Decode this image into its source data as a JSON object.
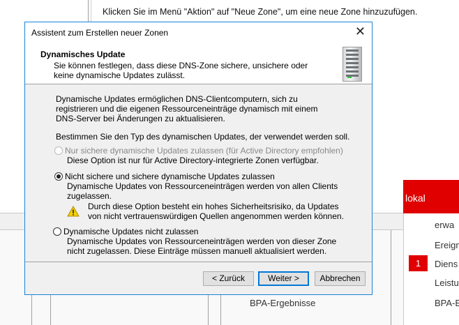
{
  "background": {
    "hint": "Klicken Sie im Menü \"Aktion\" auf \"Neue Zone\", um eine neue Zone hinzuzufügen.",
    "tile_title": "lokal",
    "tile_items": [
      "erwa",
      "Ereign",
      "Diens",
      "Leistu",
      "BPA-E"
    ],
    "badge_count": "1",
    "bpa_label": "BPA-Ergebnisse"
  },
  "dialog": {
    "title": "Assistent zum Erstellen neuer Zonen",
    "header_title": "Dynamisches Update",
    "header_desc": "Sie können festlegen, dass diese DNS-Zone sichere, unsichere oder keine dynamische Updates zulässt.",
    "intro": "Dynamische Updates ermöglichen DNS-Clientcomputern, sich zu registrieren und die eigenen Ressourceneinträge dynamisch mit einem DNS-Server bei Änderungen zu aktualisieren.",
    "prompt": "Bestimmen Sie den Typ des dynamischen Updates, der verwendet werden soll.",
    "options": [
      {
        "label": "Nur sichere dynamische Updates zulassen (für Active Directory empfohlen)",
        "desc": "Diese Option ist nur für Active Directory-integrierte Zonen verfügbar.",
        "state": "disabled"
      },
      {
        "label": "Nicht sichere und sichere dynamische Updates zulassen",
        "desc": "Dynamische Updates von Ressourceneinträgen werden von allen Clients zugelassen.",
        "warning": "Durch diese Option besteht ein hohes Sicherheitsrisiko, da Updates von nicht vertrauenswürdigen Quellen angenommen werden können.",
        "state": "selected"
      },
      {
        "label": "Dynamische Updates nicht zulassen",
        "desc": "Dynamische Updates von Ressourceneinträgen werden von dieser Zone nicht zugelassen. Diese Einträge müssen manuell aktualisiert werden.",
        "state": "unselected"
      }
    ],
    "buttons": {
      "back": "< Zurück",
      "next": "Weiter >",
      "cancel": "Abbrechen"
    },
    "colors": {
      "accent": "#0078d7",
      "tile_red": "#e00000"
    }
  }
}
